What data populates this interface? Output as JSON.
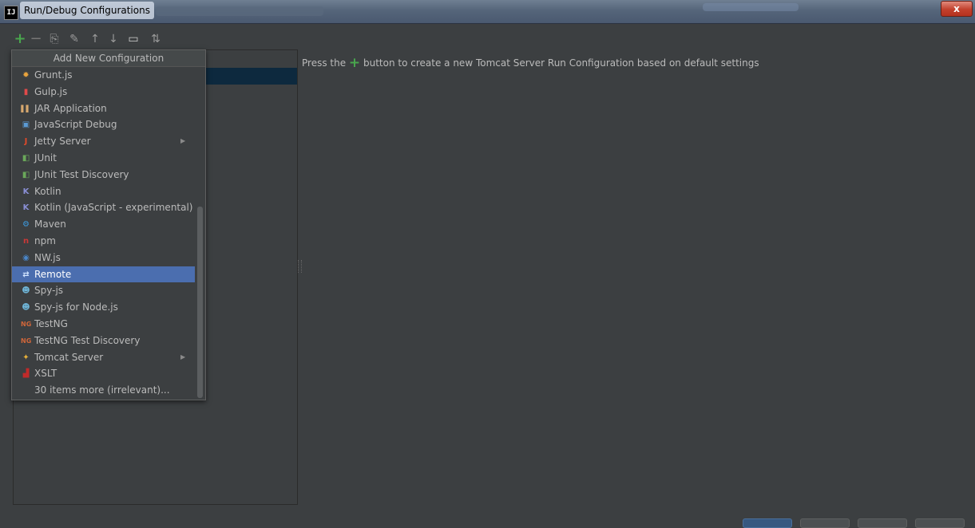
{
  "window": {
    "title": "Run/Debug Configurations",
    "close_label": "x"
  },
  "toolbar": {
    "buttons": [
      {
        "name": "add-icon",
        "glyph": "+"
      },
      {
        "name": "remove-icon",
        "glyph": "−"
      },
      {
        "name": "copy-icon",
        "glyph": "⎘"
      },
      {
        "name": "edit-defaults-icon",
        "glyph": "✎"
      },
      {
        "name": "move-up-icon",
        "glyph": "↑"
      },
      {
        "name": "move-down-icon",
        "glyph": "↓"
      },
      {
        "name": "folder-icon",
        "glyph": "▭"
      },
      {
        "name": "sort-icon",
        "glyph": "⇅"
      }
    ]
  },
  "popup": {
    "header": "Add New Configuration",
    "items": [
      {
        "label": "Grunt.js",
        "icon": "grunt-icon",
        "glyph": "✹",
        "color": "#e8a33d"
      },
      {
        "label": "Gulp.js",
        "icon": "gulp-icon",
        "glyph": "▮",
        "color": "#e04a4a"
      },
      {
        "label": "JAR Application",
        "icon": "jar-icon",
        "glyph": "▌▌",
        "color": "#d7a86e"
      },
      {
        "label": "JavaScript Debug",
        "icon": "js-debug-icon",
        "glyph": "▣",
        "color": "#5b9bd5"
      },
      {
        "label": "Jetty Server",
        "icon": "jetty-icon",
        "glyph": "J",
        "color": "#e04a2a",
        "submenu": true
      },
      {
        "label": "JUnit",
        "icon": "junit-icon",
        "glyph": "◧",
        "color": "#6aa85a"
      },
      {
        "label": "JUnit Test Discovery",
        "icon": "junit-discovery-icon",
        "glyph": "◧",
        "color": "#6aa85a"
      },
      {
        "label": "Kotlin",
        "icon": "kotlin-icon",
        "glyph": "K",
        "color": "#8a8fd6"
      },
      {
        "label": "Kotlin (JavaScript - experimental)",
        "icon": "kotlin-js-icon",
        "glyph": "K",
        "color": "#8a8fd6"
      },
      {
        "label": "Maven",
        "icon": "maven-icon",
        "glyph": "⚙",
        "color": "#3c9be0"
      },
      {
        "label": "npm",
        "icon": "npm-icon",
        "glyph": "n",
        "color": "#cb3837"
      },
      {
        "label": "NW.js",
        "icon": "nwjs-icon",
        "glyph": "◉",
        "color": "#4a86c8"
      },
      {
        "label": "Remote",
        "icon": "remote-icon",
        "glyph": "⇄",
        "color": "#d0e4ff",
        "selected": true
      },
      {
        "label": "Spy-js",
        "icon": "spy-js-icon",
        "glyph": "☻",
        "color": "#6fb6d9"
      },
      {
        "label": "Spy-js for Node.js",
        "icon": "spy-js-node-icon",
        "glyph": "☻",
        "color": "#6fb6d9"
      },
      {
        "label": "TestNG",
        "icon": "testng-icon",
        "glyph": "NG",
        "color": "#d0663a"
      },
      {
        "label": "TestNG Test Discovery",
        "icon": "testng-discovery-icon",
        "glyph": "NG",
        "color": "#d0663a"
      },
      {
        "label": "Tomcat Server",
        "icon": "tomcat-icon",
        "glyph": "✦",
        "color": "#e8b23a",
        "submenu": true
      },
      {
        "label": "XSLT",
        "icon": "xslt-icon",
        "glyph": "▟",
        "color": "#c02a2a"
      },
      {
        "label": "30 items more (irrelevant)...",
        "icon": "",
        "glyph": "",
        "color": ""
      }
    ]
  },
  "content": {
    "message_before": "Press the",
    "plus_glyph": "+",
    "message_after": " button to create a new Tomcat Server Run Configuration based on default settings"
  }
}
